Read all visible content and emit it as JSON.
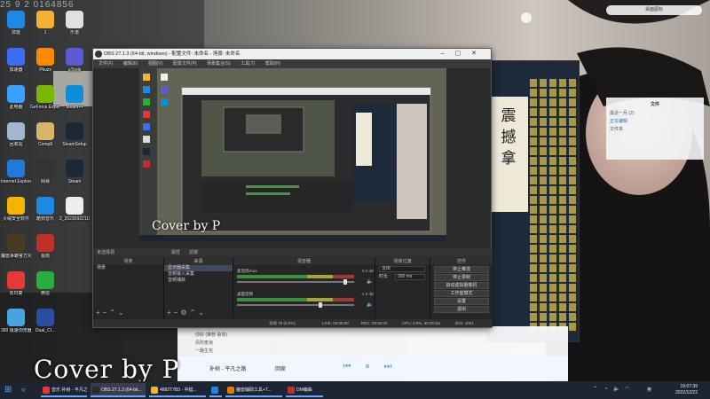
{
  "ticker": "25 9 2 0164856",
  "desktop": {
    "icons": [
      {
        "label": "技能",
        "color": "#1e88e5"
      },
      {
        "label": "1",
        "color": "#f2b233"
      },
      {
        "label": "乐谱",
        "color": "#e0e0e0"
      },
      {
        "label": "加速器",
        "color": "#3a6ef5"
      },
      {
        "label": "Pkuzx",
        "color": "#ff8a00"
      },
      {
        "label": "uTools",
        "color": "#5b5bd6"
      },
      {
        "label": "此电脑",
        "color": "#3aa0ff"
      },
      {
        "label": "GeForce Experience",
        "color": "#76b900"
      },
      {
        "label": "Steam++",
        "color": "#0d8ed9"
      },
      {
        "label": "回收站",
        "color": "#9fb7d0"
      },
      {
        "label": "Comp8",
        "color": "#d8b46a"
      },
      {
        "label": "SteamSetup",
        "color": "#1b2838"
      },
      {
        "label": "Internet Explorer",
        "color": "#1f7ad8"
      },
      {
        "label": "网易",
        "color": "#333333"
      },
      {
        "label": "Steam",
        "color": "#1b2838"
      },
      {
        "label": "火绒安全软件",
        "color": "#f4b400"
      },
      {
        "label": "酷狗音乐",
        "color": "#1e88e5"
      },
      {
        "label": "2_20230922110825",
        "color": "#eeeeee"
      },
      {
        "label": "魔兽争霸官方对战平台",
        "color": "#4a3a20"
      },
      {
        "label": "极限",
        "color": "#c2302a"
      },
      {
        "label": "腾讯QQ",
        "color": "#1e1e1e"
      },
      {
        "label": "向日葵",
        "color": "#e53935"
      },
      {
        "label": "微信",
        "color": "#2aae3e"
      },
      {
        "label": "OBS Studio",
        "color": "#2b2b2b"
      },
      {
        "label": "360 极速浏览器X",
        "color": "#4aa3df"
      },
      {
        "label": "Dual_Cl...",
        "color": "#2a4fa0"
      }
    ]
  },
  "obs": {
    "title": "OBS 27.1.3 (64-bit, windows) - 配置文件: 未命名 - 场景: 未命名",
    "menu": [
      "文件(F)",
      "编辑(E)",
      "视图(V)",
      "配置文件(P)",
      "场景集合(S)",
      "工具(T)",
      "帮助(H)"
    ],
    "preview_watermark": "Cover by P",
    "no_source": "未选择源",
    "props_label": "属性",
    "filters_label": "滤镜",
    "docks": {
      "scenes": {
        "header": "场景",
        "items": [
          "场景"
        ]
      },
      "sources": {
        "header": "来源",
        "items": [
          "显示器采集",
          "音频输入采集",
          "音频捕获"
        ]
      },
      "mixer": {
        "header": "混音器",
        "rows": [
          {
            "name": "麦克风/Aux",
            "db": "0.0 dB"
          },
          {
            "name": "桌面音频",
            "db": "-4.8 dB"
          }
        ]
      },
      "transitions": {
        "header": "场景过渡",
        "type": "淡出",
        "duration_label": "时长",
        "duration": "300 ms"
      },
      "controls": {
        "header": "控件",
        "buttons": [
          "停止推流",
          "停止录制",
          "启动虚拟摄像机",
          "工作室模式",
          "设置",
          "退出"
        ]
      }
    },
    "status": {
      "dropped": "丢帧 78 (0.0%)",
      "live": "LIVE: 00:55:00",
      "rec": "REC: 00:55:00",
      "cpu": "CPU: 3.9%, 60.00 fps",
      "kbps": "kb/s: 4461"
    }
  },
  "chat_app": {
    "calligraphy": [
      "震",
      "撼",
      "拿"
    ]
  },
  "right_panel": {
    "pill": "桌面图标",
    "title": "文件",
    "rows": [
      "最近一月 (2)",
      "正在编辑",
      "文件夹"
    ]
  },
  "music": {
    "rows": [
      "你好 (推荐 歌单)",
      "风吹麦浪",
      "一路生花"
    ],
    "song": "补树 - 平凡之路",
    "artist": "回家"
  },
  "watermark": "Cover by P",
  "taskbar": {
    "tasks": [
      {
        "label": "音乐 补树 - 平凡之...",
        "color": "#e53935",
        "active": false
      },
      {
        "label": "OBS 27.1.3 (64-bit...",
        "color": "#2b2b2b",
        "active": true
      },
      {
        "label": "4882T7B3 - 中蛙...",
        "color": "#f2b233",
        "active": false
      },
      {
        "label": "",
        "color": "#1e88e5",
        "active": false
      },
      {
        "label": "魔兽辅助工具+T...",
        "color": "#e07b00",
        "active": false
      },
      {
        "label": "DM编曲",
        "color": "#c2302a",
        "active": false
      }
    ],
    "lang": "英",
    "time": "19:07:39",
    "date": "2022/12/22"
  }
}
